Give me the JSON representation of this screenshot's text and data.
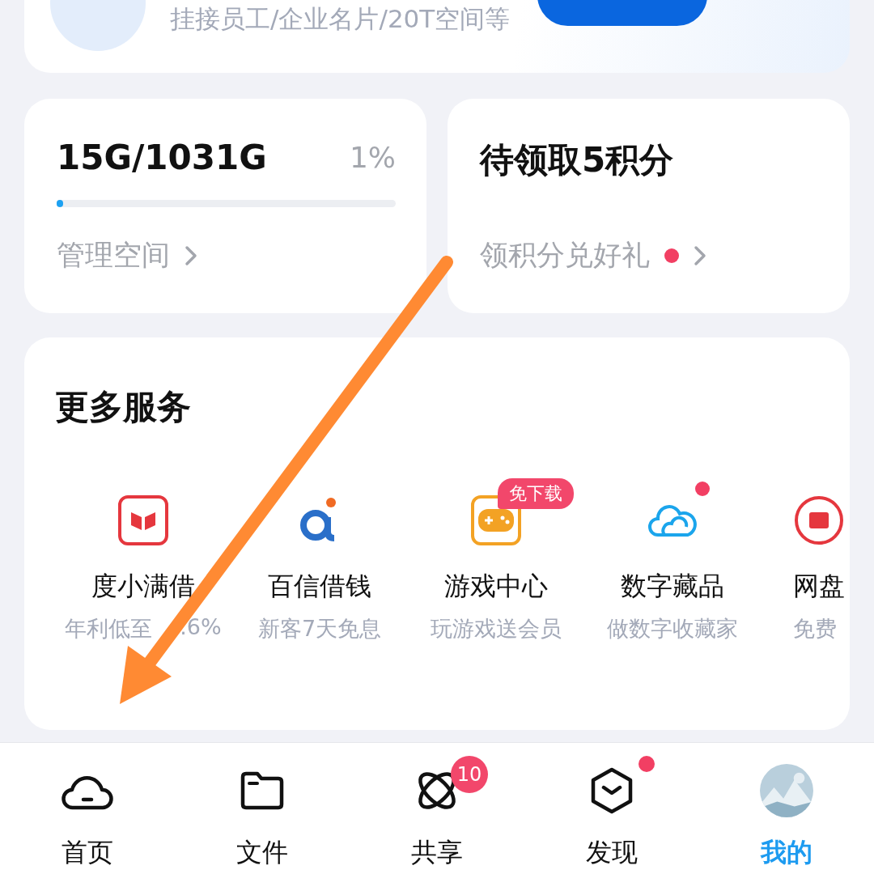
{
  "promo": {
    "subtitle": "挂接员工/企业名片/20T空间等"
  },
  "storage": {
    "usage": "15G/1031G",
    "percent": "1%",
    "level": 0.01,
    "link": "管理空间"
  },
  "points": {
    "title": "待领取5积分",
    "link": "领积分兑好礼",
    "dot": true
  },
  "services": {
    "title": "更多服务",
    "items": [
      {
        "name": "度小满借",
        "desc": "年利低至",
        "desc_tail": ".6%"
      },
      {
        "name": "百信借钱",
        "desc": "新客7天免息"
      },
      {
        "name": "游戏中心",
        "desc": "玩游戏送会员",
        "badge": "免下载"
      },
      {
        "name": "数字藏品",
        "desc": "做数字收藏家",
        "dot": true
      },
      {
        "name": "网盘",
        "desc": "免费"
      }
    ]
  },
  "nav": [
    {
      "label": "首页",
      "selected": false
    },
    {
      "label": "文件",
      "selected": false
    },
    {
      "label": "共享",
      "selected": false,
      "badge": "10"
    },
    {
      "label": "发现",
      "selected": false,
      "dot": true
    },
    {
      "label": "我的",
      "selected": true
    }
  ]
}
